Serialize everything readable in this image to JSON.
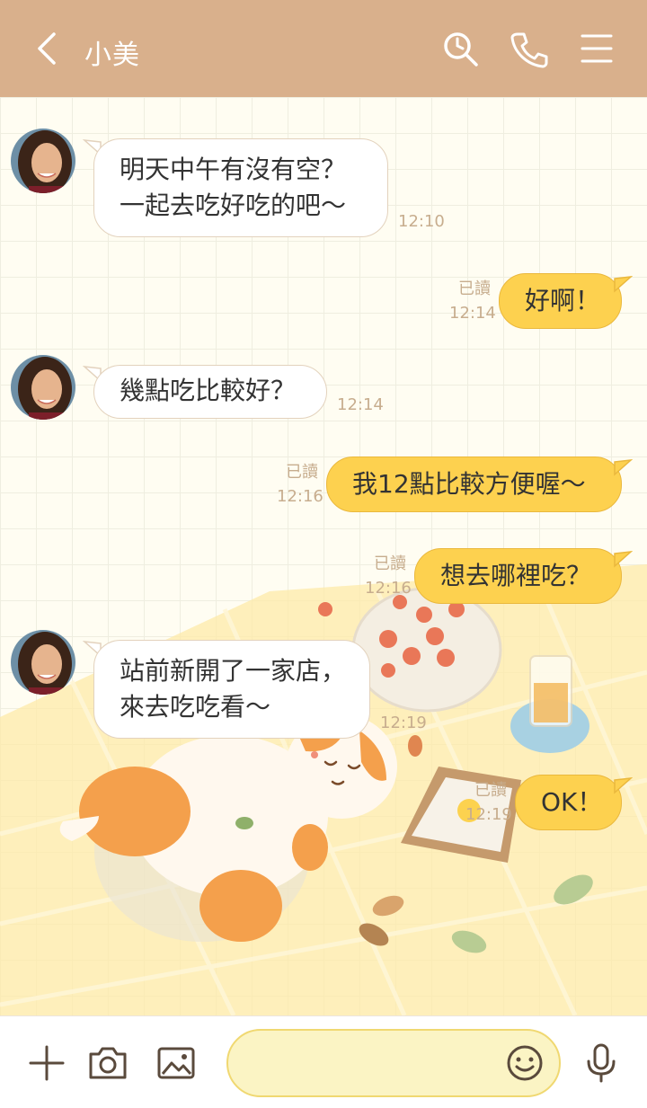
{
  "header": {
    "contact_name": "小美"
  },
  "messages": [
    {
      "lines": [
        "明天中午有沒有空？",
        "一起去吃好吃的吧～"
      ],
      "time": "12:10"
    },
    {
      "lines": [
        "好啊！"
      ],
      "read": "已讀",
      "time": "12:14"
    },
    {
      "lines": [
        "幾點吃比較好？"
      ],
      "time": "12:14"
    },
    {
      "lines": [
        "我12點比較方便喔～"
      ],
      "read": "已讀",
      "time": "12:16"
    },
    {
      "lines": [
        "想去哪裡吃？"
      ],
      "read": "已讀",
      "time": "12:16"
    },
    {
      "lines": [
        "站前新開了一家店，",
        "來去吃吃看～"
      ],
      "time": "12:19"
    },
    {
      "lines": [
        "OK！"
      ],
      "read": "已讀",
      "time": "12:19"
    }
  ],
  "input": {
    "value": ""
  },
  "colors": {
    "header": "#d9b08c",
    "bubble_out": "#fdd14f",
    "bubble_in": "#ffffff",
    "meta": "#c7ad8e"
  }
}
